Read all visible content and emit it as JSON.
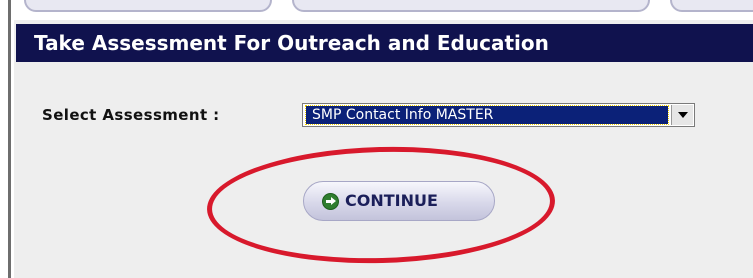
{
  "page": {
    "title": "Take Assessment For Outreach and Education"
  },
  "form": {
    "select_label": "Select Assessment :",
    "select_value": "SMP Contact Info MASTER"
  },
  "actions": {
    "continue_label": "CONTINUE"
  },
  "annotation": {
    "color": "#d8192c"
  }
}
